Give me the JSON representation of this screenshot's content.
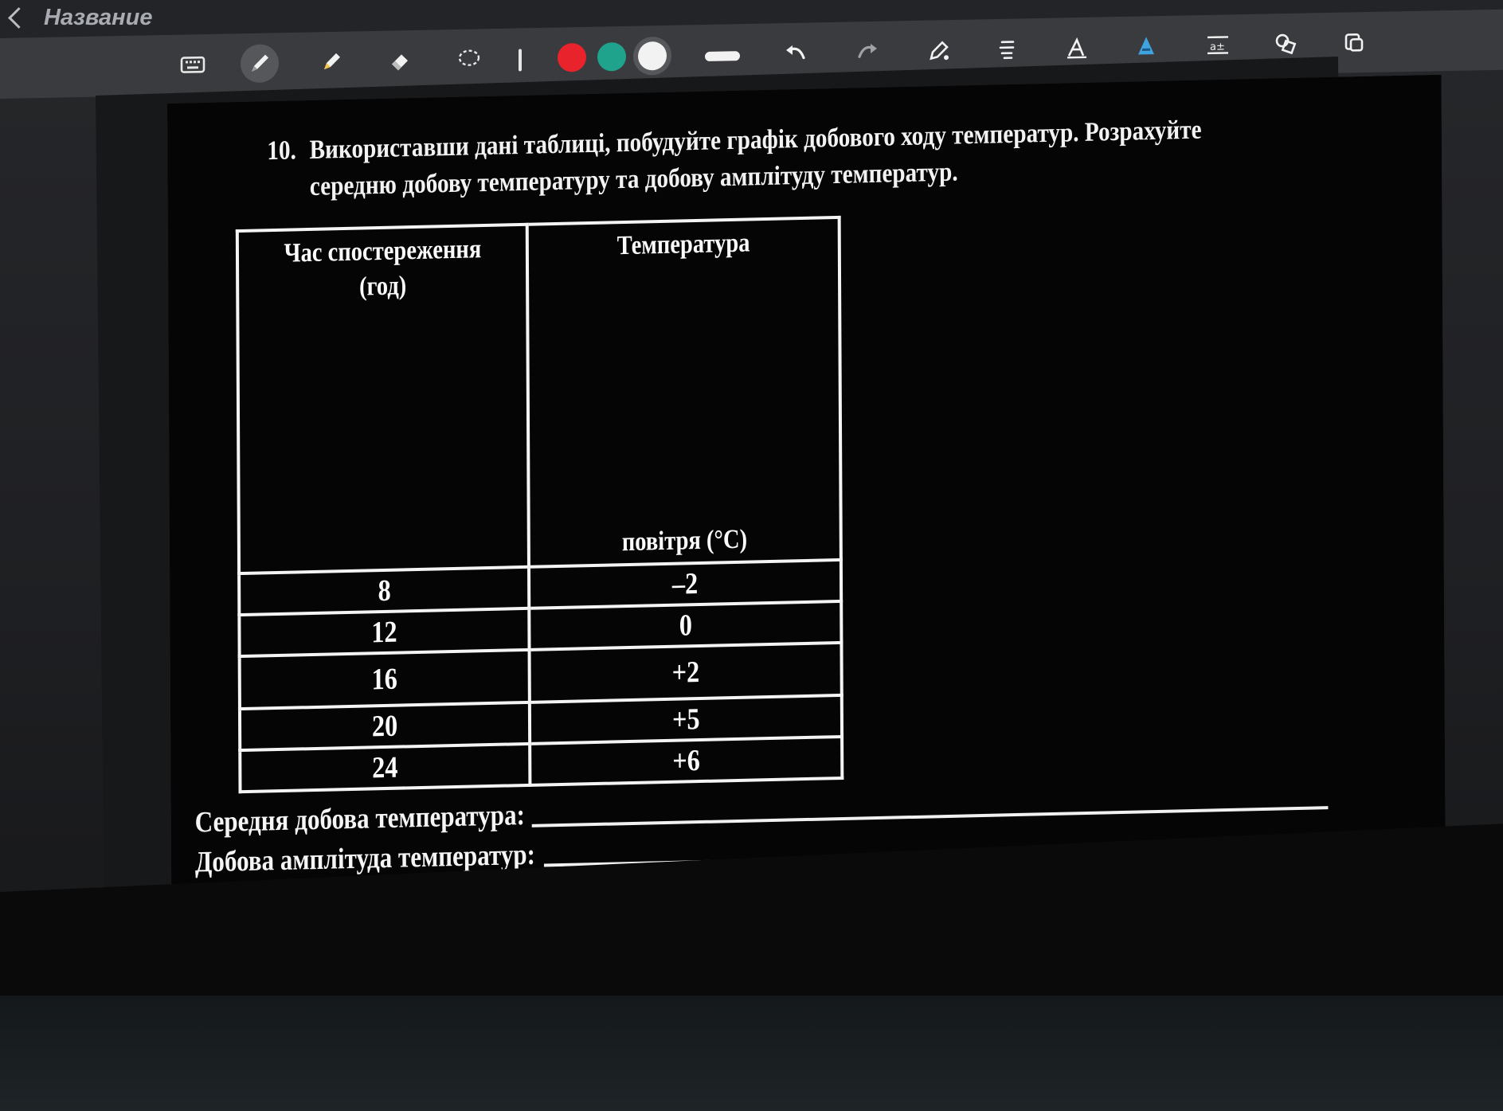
{
  "app": {
    "title": "Название"
  },
  "toolbar": {
    "tools": [
      "keyboard-icon",
      "pen-icon",
      "highlighter-icon",
      "eraser-icon",
      "lasso-icon"
    ],
    "colors": [
      "#e8232b",
      "#1fa38c",
      "#f2f2f2"
    ],
    "actions": [
      "undo-icon",
      "redo-icon",
      "pen-settings-icon",
      "text-style-icon",
      "text-tool-icon",
      "fill-icon",
      "text-format-icon",
      "shapes-icon",
      "copy-icon"
    ]
  },
  "question": {
    "number": "10.",
    "line1": "Використавши дані таблиці, побудуйте графік добового ходу температур. Розрахуйте",
    "line2": "середню добову температуру та добову амплітуду температур."
  },
  "table": {
    "header_time_line1": "Час спостереження",
    "header_time_line2": "(год)",
    "header_temp_line1": "Температура",
    "header_temp_line2": "повітря (°С)",
    "rows": [
      {
        "time": "8",
        "temp": "–2"
      },
      {
        "time": "12",
        "temp": "0"
      },
      {
        "time": "16",
        "temp": "+2"
      },
      {
        "time": "20",
        "temp": "+5"
      },
      {
        "time": "24",
        "temp": "+6"
      }
    ]
  },
  "answers": {
    "avg_label": "Середня добова температура:",
    "amp_label": "Добова амплітуда температур:"
  }
}
